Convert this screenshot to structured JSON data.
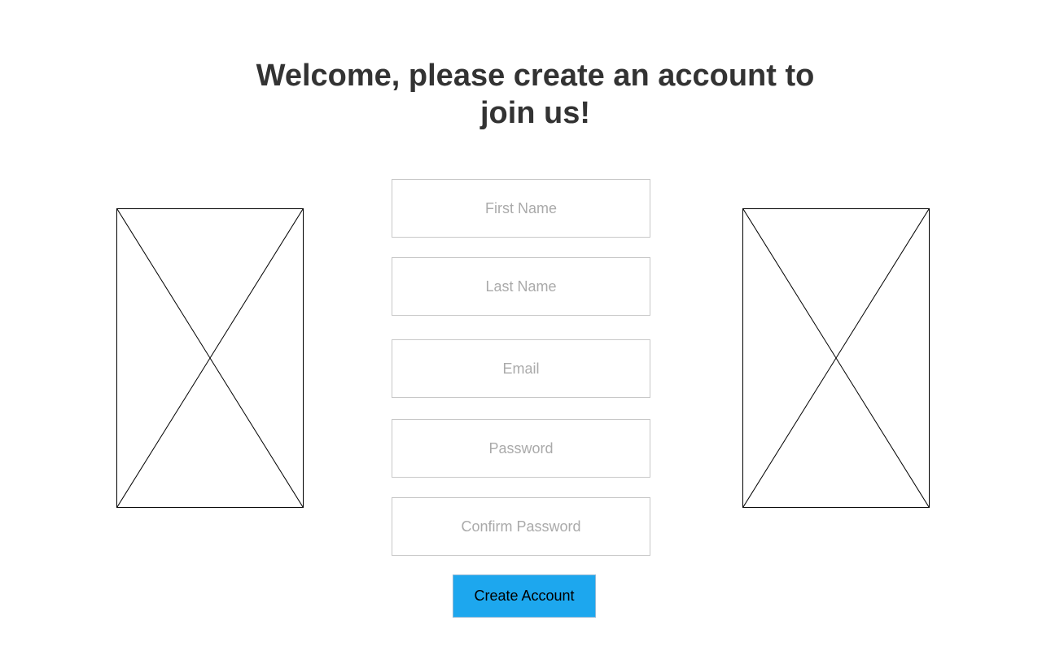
{
  "heading": {
    "title": "Welcome, please create an account to join us!"
  },
  "form": {
    "first_name": {
      "placeholder": "First Name",
      "value": ""
    },
    "last_name": {
      "placeholder": "Last Name",
      "value": ""
    },
    "email": {
      "placeholder": "Email",
      "value": ""
    },
    "password": {
      "placeholder": "Password",
      "value": ""
    },
    "confirm_password": {
      "placeholder": "Confirm Password",
      "value": ""
    },
    "submit_label": "Create Account"
  },
  "colors": {
    "button_background": "#1da7ee",
    "heading_text": "#333333",
    "placeholder_text": "#aaaaaa",
    "field_border": "#c8c8c8"
  },
  "icons": {
    "left_image": "image-placeholder-icon",
    "right_image": "image-placeholder-icon"
  }
}
